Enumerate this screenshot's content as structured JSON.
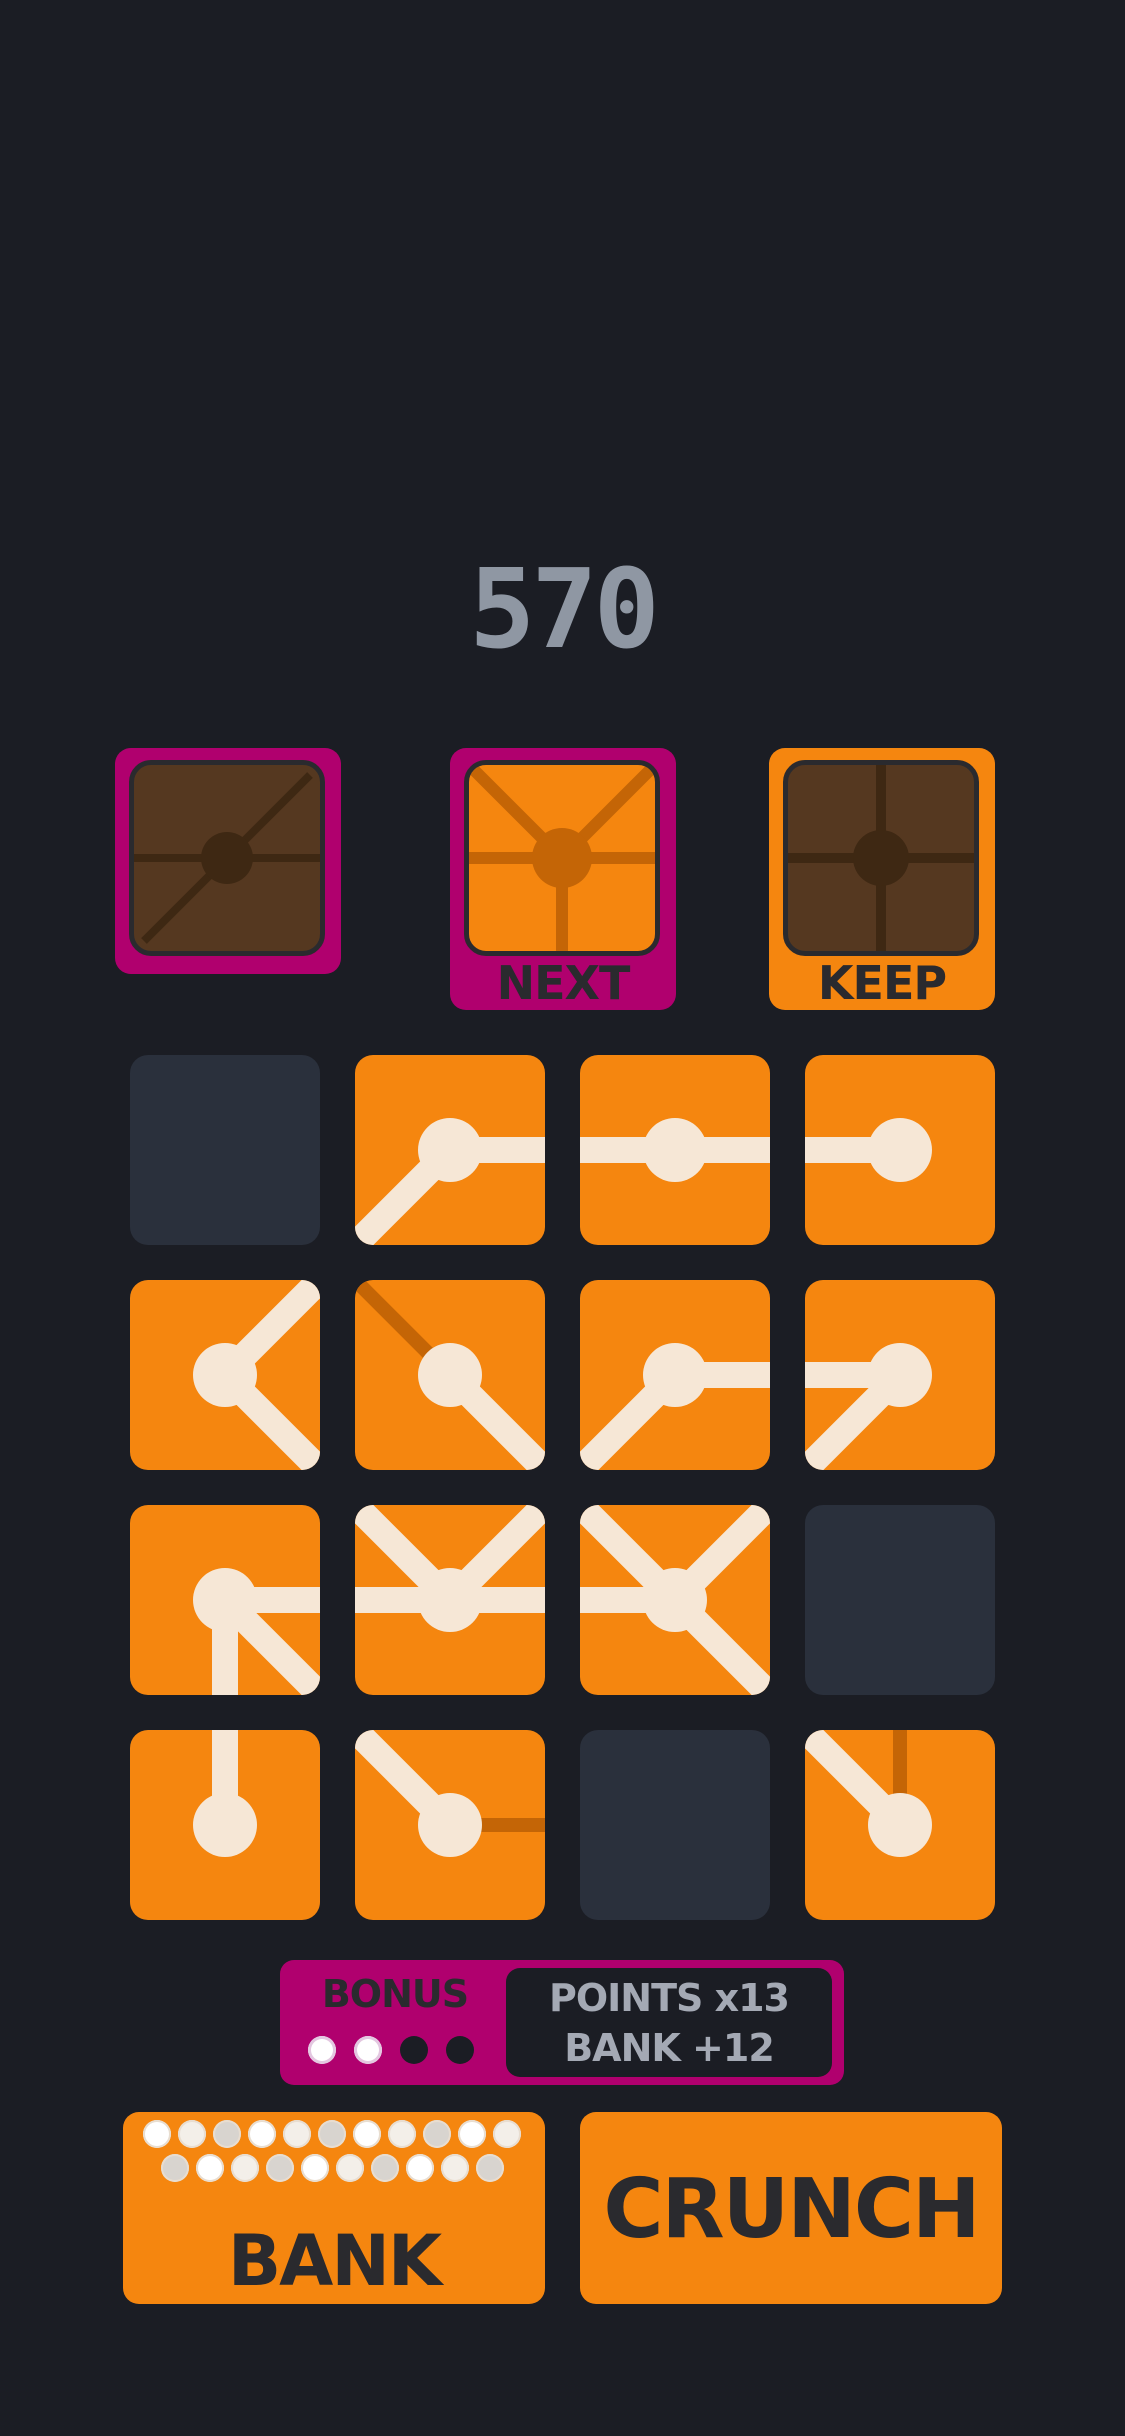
{
  "score": "570",
  "preview": {
    "previous_label": "",
    "next_label": "NEXT",
    "keep_label": "KEEP",
    "frame_magenta": "#b0006e",
    "frame_orange": "#f5860f",
    "dark_tile": "#553820",
    "next_tile": "#f5860f"
  },
  "board": {
    "rows": 4,
    "cols": 4,
    "tile_color": "#f5860f",
    "empty_color": "#2a303c",
    "tiles": [
      {
        "row": 0,
        "col": 0,
        "state": "empty",
        "active": [],
        "inactive": []
      },
      {
        "row": 0,
        "col": 1,
        "state": "filled",
        "active": [
          "E",
          "SW"
        ],
        "inactive": []
      },
      {
        "row": 0,
        "col": 2,
        "state": "filled",
        "active": [
          "E",
          "W"
        ],
        "inactive": []
      },
      {
        "row": 0,
        "col": 3,
        "state": "filled",
        "active": [
          "W"
        ],
        "inactive": []
      },
      {
        "row": 1,
        "col": 0,
        "state": "filled",
        "active": [
          "NE",
          "SE"
        ],
        "inactive": []
      },
      {
        "row": 1,
        "col": 1,
        "state": "filled",
        "active": [
          "SE"
        ],
        "inactive": [
          "NW"
        ]
      },
      {
        "row": 1,
        "col": 2,
        "state": "filled",
        "active": [
          "E",
          "SW"
        ],
        "inactive": []
      },
      {
        "row": 1,
        "col": 3,
        "state": "filled",
        "active": [
          "W",
          "SW"
        ],
        "inactive": []
      },
      {
        "row": 2,
        "col": 0,
        "state": "filled",
        "active": [
          "E",
          "S",
          "SE"
        ],
        "inactive": []
      },
      {
        "row": 2,
        "col": 1,
        "state": "filled",
        "active": [
          "NW",
          "NE",
          "E",
          "W"
        ],
        "inactive": []
      },
      {
        "row": 2,
        "col": 2,
        "state": "filled",
        "active": [
          "NW",
          "NE",
          "W",
          "SE"
        ],
        "inactive": []
      },
      {
        "row": 2,
        "col": 3,
        "state": "empty",
        "active": [],
        "inactive": []
      },
      {
        "row": 3,
        "col": 0,
        "state": "filled",
        "active": [
          "N"
        ],
        "inactive": []
      },
      {
        "row": 3,
        "col": 1,
        "state": "filled",
        "active": [
          "NW"
        ],
        "inactive": [
          "E"
        ]
      },
      {
        "row": 3,
        "col": 2,
        "state": "empty",
        "active": [],
        "inactive": []
      },
      {
        "row": 3,
        "col": 3,
        "state": "filled",
        "active": [
          "NW"
        ],
        "inactive": [
          "N"
        ]
      }
    ]
  },
  "bonus": {
    "label": "BONUS",
    "dots_filled": 2,
    "dots_total": 4,
    "points_text": "POINTS x13",
    "bank_text": "BANK +12"
  },
  "bank": {
    "label": "BANK",
    "pearls_total": 21,
    "pearl_colors": [
      "#ffffff",
      "#f3efe9",
      "#d8d4cf"
    ]
  },
  "crunch": {
    "label": "CRUNCH"
  }
}
